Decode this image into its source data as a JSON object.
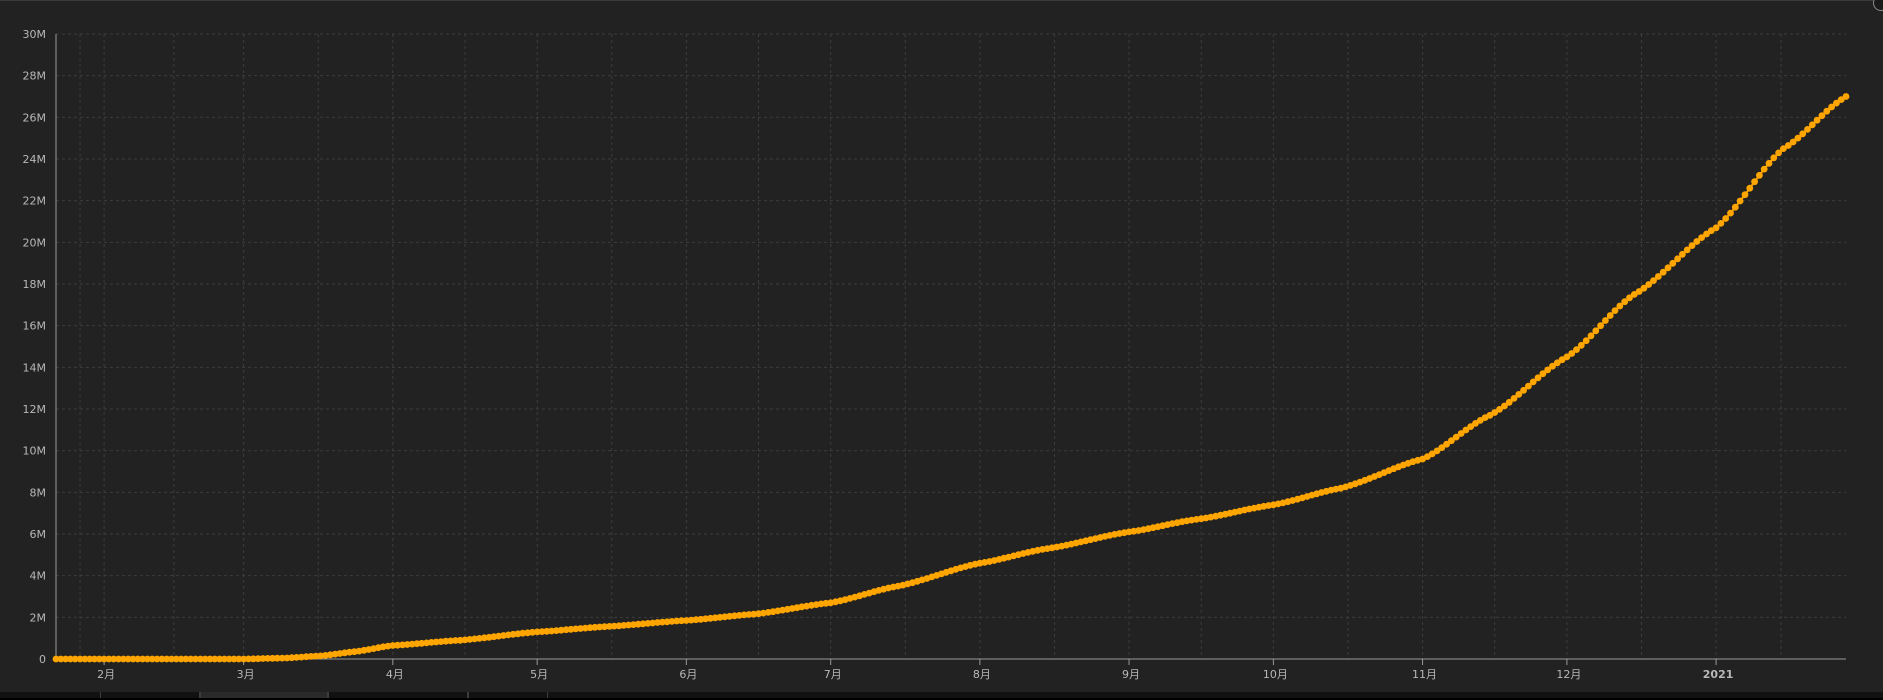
{
  "chart_data": {
    "type": "line",
    "title": "",
    "xlabel": "",
    "ylabel": "",
    "grid": true,
    "markers": true,
    "colors": {
      "series": "#FFA500",
      "background": "#222222",
      "grid": "#3c3c3c",
      "axis_text": "#b8b8b8"
    },
    "ylim": [
      0,
      30000000
    ],
    "xlim": [
      "2020-01-22",
      "2021-01-28"
    ],
    "y_ticks": [
      {
        "value": 0,
        "label": "0"
      },
      {
        "value": 2000000,
        "label": "2M"
      },
      {
        "value": 4000000,
        "label": "4M"
      },
      {
        "value": 6000000,
        "label": "6M"
      },
      {
        "value": 8000000,
        "label": "8M"
      },
      {
        "value": 10000000,
        "label": "10M"
      },
      {
        "value": 12000000,
        "label": "12M"
      },
      {
        "value": 14000000,
        "label": "14M"
      },
      {
        "value": 16000000,
        "label": "16M"
      },
      {
        "value": 18000000,
        "label": "18M"
      },
      {
        "value": 20000000,
        "label": "20M"
      },
      {
        "value": 22000000,
        "label": "22M"
      },
      {
        "value": 24000000,
        "label": "24M"
      },
      {
        "value": 26000000,
        "label": "26M"
      },
      {
        "value": 28000000,
        "label": "28M"
      },
      {
        "value": 30000000,
        "label": "30M"
      }
    ],
    "x_ticks": [
      {
        "value": "2020-02-01",
        "label": "2月"
      },
      {
        "value": "2020-03-01",
        "label": "3月"
      },
      {
        "value": "2020-04-01",
        "label": "4月"
      },
      {
        "value": "2020-05-01",
        "label": "5月"
      },
      {
        "value": "2020-06-01",
        "label": "6月"
      },
      {
        "value": "2020-07-01",
        "label": "7月"
      },
      {
        "value": "2020-08-01",
        "label": "8月"
      },
      {
        "value": "2020-09-01",
        "label": "9月"
      },
      {
        "value": "2020-10-01",
        "label": "10月"
      },
      {
        "value": "2020-11-01",
        "label": "11月"
      },
      {
        "value": "2020-12-01",
        "label": "12月"
      },
      {
        "value": "2021-01-01",
        "label": "2021"
      }
    ],
    "series": [
      {
        "points": [
          [
            "2020-01-22",
            0
          ],
          [
            "2020-02-01",
            0
          ],
          [
            "2020-02-15",
            0
          ],
          [
            "2020-03-01",
            0
          ],
          [
            "2020-03-10",
            50000
          ],
          [
            "2020-03-17",
            150000
          ],
          [
            "2020-03-24",
            350000
          ],
          [
            "2020-04-01",
            650000
          ],
          [
            "2020-04-15",
            900000
          ],
          [
            "2020-05-01",
            1300000
          ],
          [
            "2020-05-15",
            1550000
          ],
          [
            "2020-06-01",
            1850000
          ],
          [
            "2020-06-15",
            2150000
          ],
          [
            "2020-07-01",
            2700000
          ],
          [
            "2020-07-15",
            3500000
          ],
          [
            "2020-08-01",
            4600000
          ],
          [
            "2020-08-15",
            5300000
          ],
          [
            "2020-09-01",
            6100000
          ],
          [
            "2020-09-15",
            6700000
          ],
          [
            "2020-10-01",
            7400000
          ],
          [
            "2020-10-15",
            8200000
          ],
          [
            "2020-11-01",
            9600000
          ],
          [
            "2020-11-15",
            11700000
          ],
          [
            "2020-12-01",
            14500000
          ],
          [
            "2020-12-15",
            17500000
          ],
          [
            "2021-01-01",
            20700000
          ],
          [
            "2021-01-15",
            24500000
          ],
          [
            "2021-01-28",
            27000000
          ]
        ]
      }
    ]
  }
}
